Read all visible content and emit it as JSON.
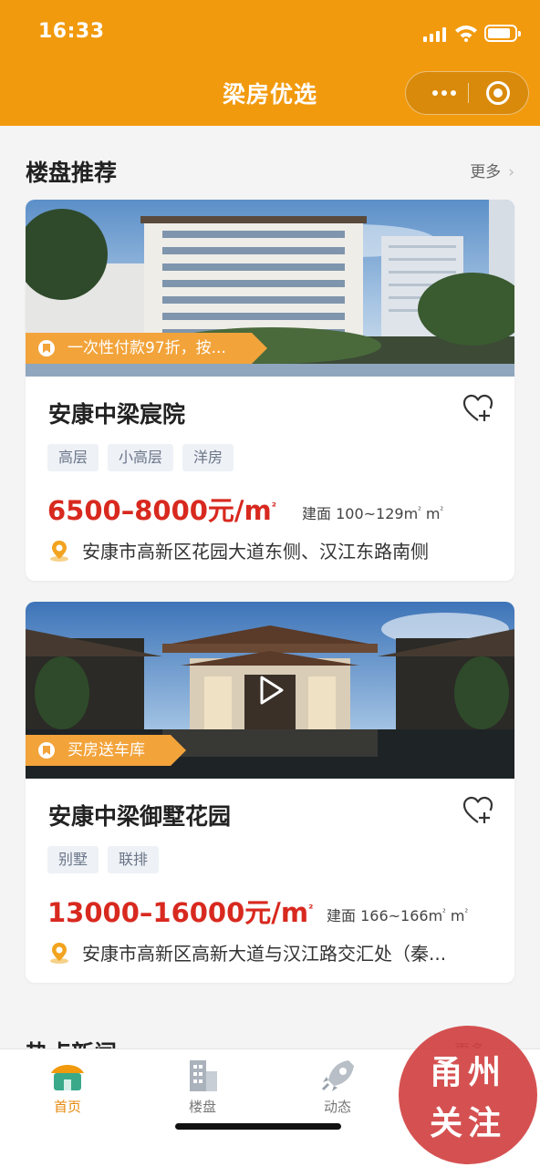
{
  "status_bar": {
    "time": "16:33"
  },
  "header": {
    "title": "梁房优选",
    "capsule": {
      "more_icon": "ellipsis-icon",
      "close_icon": "target-icon"
    }
  },
  "featured": {
    "title": "楼盘推荐",
    "more_label": "更多",
    "more_chevron": "›"
  },
  "listings": [
    {
      "promo": "一次性付款97折，按...",
      "name": "安康中梁宸院",
      "tags": [
        "高层",
        "小高层",
        "洋房"
      ],
      "price": "6500–8000元/m",
      "price_unit_sup": "²",
      "area_label": "建面 100~129m",
      "area_sup": "²",
      "area_suffix": " m",
      "area_suffix_sup": "²",
      "address": "安康市高新区花园大道东侧、汉江东路南侧",
      "has_video": false
    },
    {
      "promo": "买房送车库",
      "name": "安康中梁御墅花园",
      "tags": [
        "别墅",
        "联排"
      ],
      "price": "13000–16000元/m",
      "price_unit_sup": "²",
      "area_label": "建面 166~166m",
      "area_sup": "²",
      "area_suffix": " m",
      "area_suffix_sup": "²",
      "address": "安康市高新区高新大道与汉江路交汇处（秦...",
      "has_video": true
    }
  ],
  "news": {
    "title": "热点新闻",
    "more_label": "更多"
  },
  "tabbar": {
    "items": [
      {
        "label": "首页",
        "icon": "home-icon",
        "active": true
      },
      {
        "label": "楼盘",
        "icon": "building-icon",
        "active": false
      },
      {
        "label": "动态",
        "icon": "rocket-icon",
        "active": false
      }
    ]
  },
  "watermark": {
    "line1": "甬州",
    "line2": "关注"
  },
  "colors": {
    "brand": "#f29a0d",
    "price": "#d8291f",
    "ribbon": "#f2a33a",
    "tab_active": "#e8880c"
  }
}
